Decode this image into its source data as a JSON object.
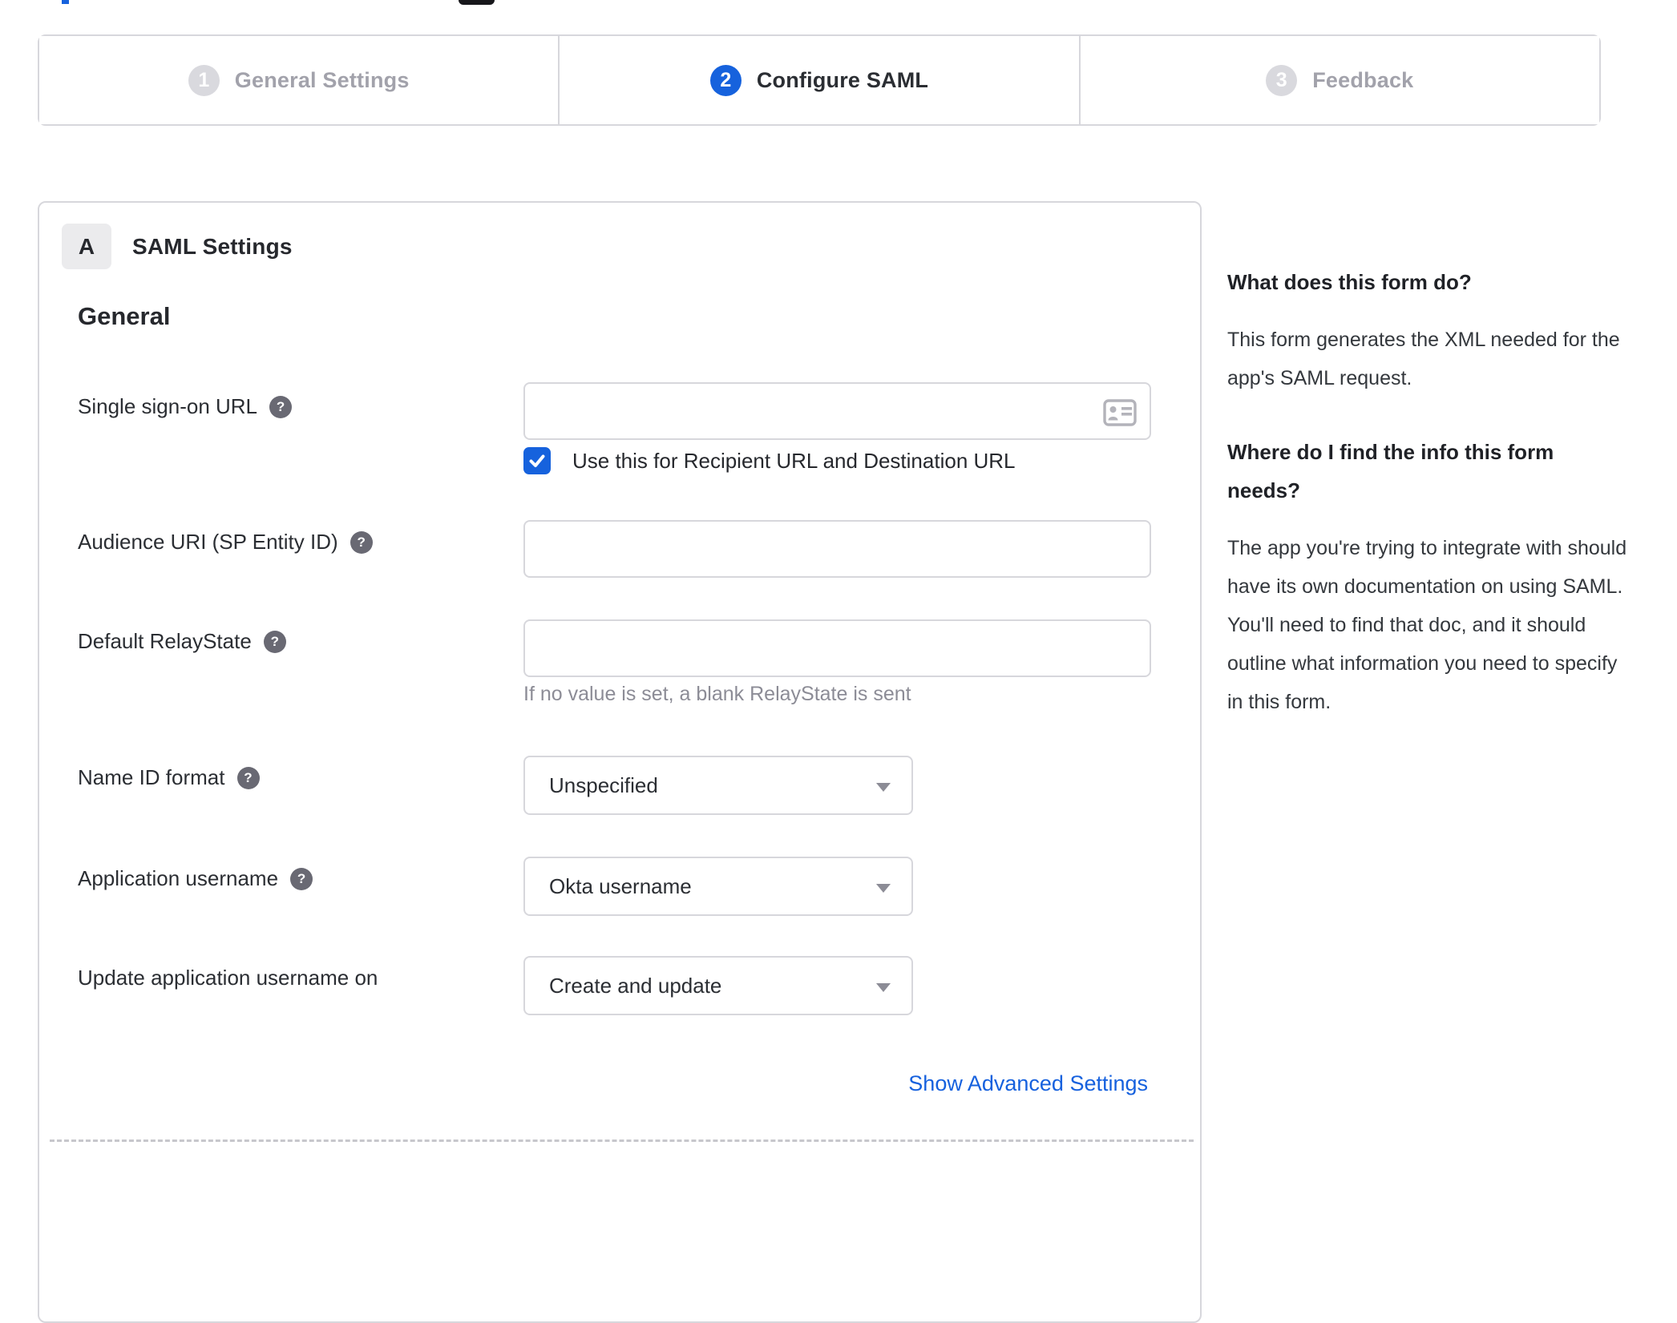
{
  "colors": {
    "accent_blue": "#1662dd",
    "link_blue": "#1661de",
    "border_grey": "#d7d7dc",
    "inactive_grey": "#a2a2ab",
    "text_dark": "#26282d",
    "hint_grey": "#8c8c96"
  },
  "stepper": {
    "steps": [
      {
        "number": "1",
        "label": "General Settings",
        "state": "inactive"
      },
      {
        "number": "2",
        "label": "Configure SAML",
        "state": "active"
      },
      {
        "number": "3",
        "label": "Feedback",
        "state": "inactive"
      }
    ]
  },
  "panel": {
    "section_badge": "A",
    "section_title": "SAML Settings",
    "group_heading": "General",
    "rows": [
      {
        "label": "Single sign-on URL",
        "has_help": true,
        "control": "text-input",
        "value": "",
        "icon": "address-card-icon",
        "checkbox": {
          "checked": true,
          "label": "Use this for Recipient URL and Destination URL"
        }
      },
      {
        "label": "Audience URI (SP Entity ID)",
        "has_help": true,
        "control": "text-input",
        "value": ""
      },
      {
        "label": "Default RelayState",
        "has_help": true,
        "control": "text-input",
        "value": "",
        "hint": "If no value is set, a blank RelayState is sent"
      },
      {
        "label": "Name ID format",
        "has_help": true,
        "control": "select",
        "value": "Unspecified"
      },
      {
        "label": "Application username",
        "has_help": true,
        "control": "select",
        "value": "Okta username"
      },
      {
        "label": "Update application username on",
        "has_help": false,
        "control": "select",
        "value": "Create and update"
      }
    ],
    "advanced_link": "Show Advanced Settings"
  },
  "help_icon_glyph": "?",
  "sidebar": {
    "q1": "What does this form do?",
    "a1": "This form generates the XML needed for the app's SAML request.",
    "q2": "Where do I find the info this form needs?",
    "a2": "The app you're trying to integrate with should have its own documentation on using SAML. You'll need to find that doc, and it should outline what information you need to specify in this form."
  }
}
